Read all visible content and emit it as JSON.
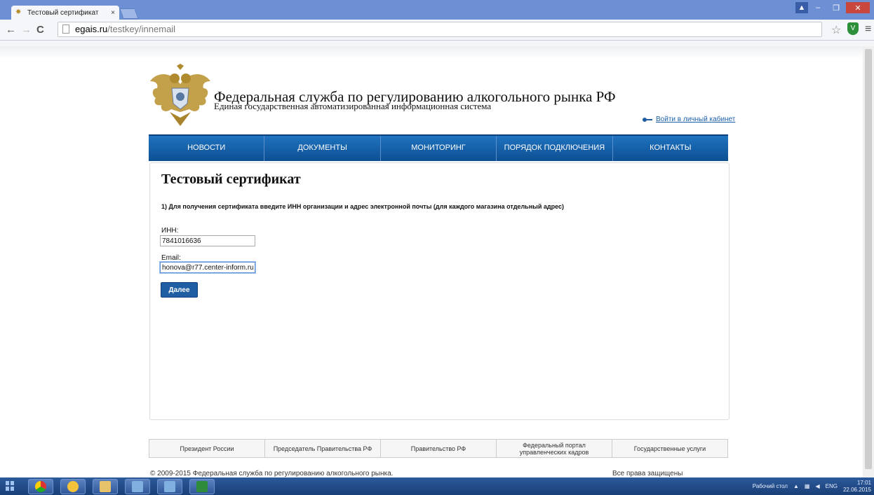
{
  "browser": {
    "tab_title": "Тестовый сертификат",
    "tab_close": "×",
    "url_domain": "egais.ru",
    "url_path": "/testkey/innemail"
  },
  "header": {
    "org_title": "Федеральная служба по регулированию алкогольного рынка РФ",
    "org_subtitle": "Единая государственная автоматизированная информационная система",
    "login_link": "Войти в личный кабинет"
  },
  "nav": {
    "items": [
      "НОВОСТИ",
      "ДОКУМЕНТЫ",
      "МОНИТОРИНГ",
      "ПОРЯДОК ПОДКЛЮЧЕНИЯ",
      "КОНТАКТЫ"
    ]
  },
  "content": {
    "page_title": "Тестовый сертификат",
    "instruction": "1) Для получения сертификата введите ИНН организации и адрес электронной почты (для каждого магазина отдельный адрес)",
    "inn_label": "ИНН:",
    "inn_value": "7841016636",
    "email_label": "Email:",
    "email_value": "honova@r77.center-inform.ru",
    "submit_label": "Далее"
  },
  "footer": {
    "links": [
      "Президент России",
      "Председатель Правительства РФ",
      "Правительство РФ",
      "Федеральный портал управленческих кадров",
      "Государственные услуги"
    ],
    "copyright": "© 2009-2015 Федеральная служба по регулированию алкогольного рынка.",
    "rights": "Все права защищены"
  },
  "taskbar": {
    "desktop_label": "Рабочий стол",
    "language": "ENG",
    "time": "17:01",
    "date": "22.06.2015"
  },
  "colors": {
    "nav_blue": "#1f5ea3",
    "link_blue": "#1b5fa8",
    "chrome_titlebar": "#6d8fd3"
  },
  "icons": [
    "emblem-icon",
    "back-icon",
    "forward-icon",
    "reload-icon",
    "page-icon",
    "star-icon",
    "extension-icon",
    "menu-icon",
    "key-icon"
  ]
}
